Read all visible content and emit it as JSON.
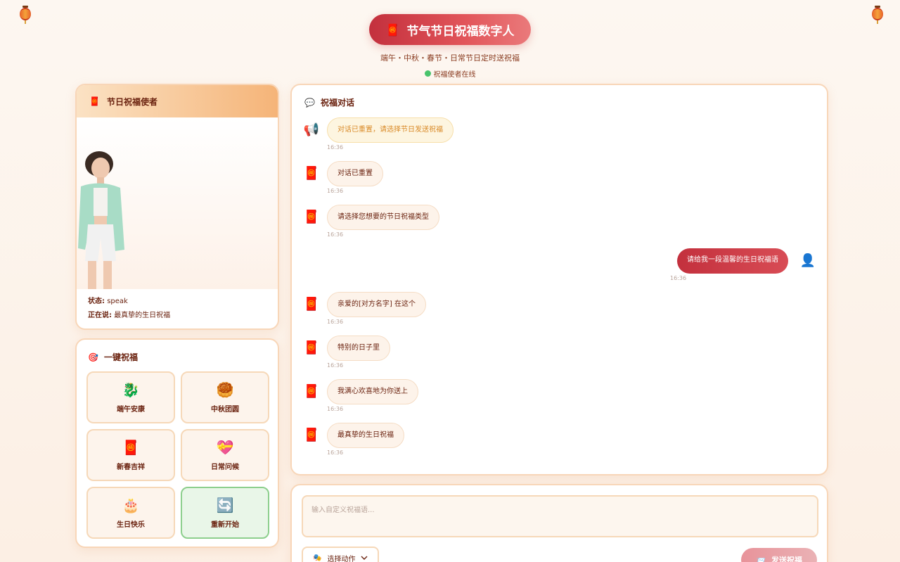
{
  "header": {
    "title": "节气节日祝福数字人",
    "title_icon": "🧧",
    "subtitle": "端午・中秋・春节・日常节日定时送祝福",
    "status": "祝福使者在线",
    "status_color": "#48c36b"
  },
  "avatar_panel": {
    "title": "节日祝福使者",
    "title_icon": "🧧",
    "state_label": "状态:",
    "state_value": "speak",
    "speaking_label": "正在说:",
    "speaking_value": "最真挚的生日祝福"
  },
  "quick_panel": {
    "title": "一键祝福",
    "title_icon": "🎯",
    "buttons": [
      {
        "icon": "🐉",
        "label": "端午安康"
      },
      {
        "icon": "🥮",
        "label": "中秋团圆"
      },
      {
        "icon": "🧧",
        "label": "新春吉祥"
      },
      {
        "icon": "💝",
        "label": "日常问候"
      },
      {
        "icon": "🎂",
        "label": "生日快乐"
      },
      {
        "icon": "🔄",
        "label": "重新开始"
      }
    ]
  },
  "chat": {
    "title": "祝福对话",
    "title_icon": "💬",
    "messages": [
      {
        "role": "system",
        "icon": "📢",
        "text": "对话已重置，请选择节日发送祝福",
        "time": "16:36"
      },
      {
        "role": "bot",
        "icon": "🧧",
        "text": "对话已重置",
        "time": "16:36"
      },
      {
        "role": "bot",
        "icon": "🧧",
        "text": "请选择您想要的节日祝福类型",
        "time": "16:36"
      },
      {
        "role": "user",
        "icon": "👤",
        "text": "请给我一段温馨的生日祝福语",
        "time": "16:36"
      },
      {
        "role": "bot",
        "icon": "🧧",
        "text": "亲爱的[对方名字] 在这个",
        "time": "16:36"
      },
      {
        "role": "bot",
        "icon": "🧧",
        "text": "特别的日子里",
        "time": "16:36"
      },
      {
        "role": "bot",
        "icon": "🧧",
        "text": "我满心欢喜地为你送上",
        "time": "16:36"
      },
      {
        "role": "bot",
        "icon": "🧧",
        "text": "最真挚的生日祝福",
        "time": "16:36"
      }
    ]
  },
  "input": {
    "placeholder": "输入自定义祝福语...",
    "action_label": "选择动作",
    "action_icon": "🎭",
    "send_label": "发送祝福",
    "send_icon": "📨"
  }
}
